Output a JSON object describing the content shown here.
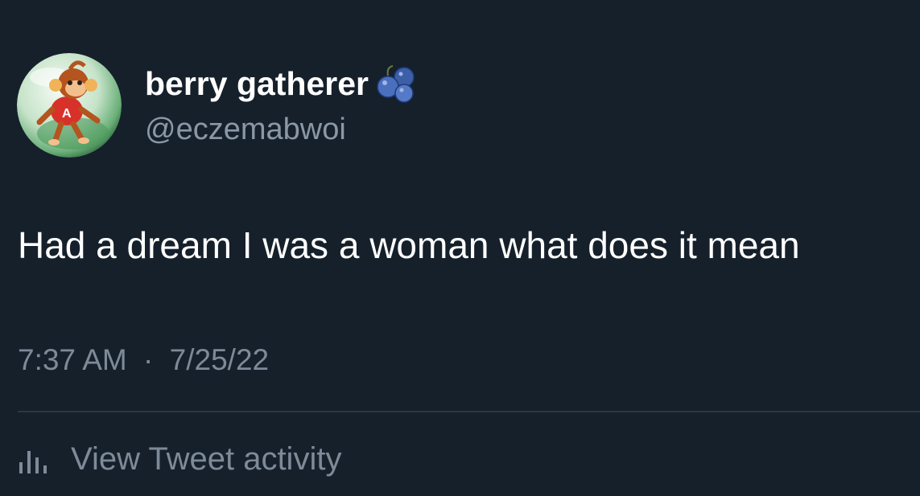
{
  "colors": {
    "background": "#16202b",
    "primary_text": "#ffffff",
    "secondary_text": "#8a98a6",
    "divider": "#2c3846"
  },
  "author": {
    "display_name": "berry gatherer",
    "name_emoji": "blueberries-icon",
    "handle": "@eczemabwoi",
    "avatar": "monkey-avatar"
  },
  "tweet": {
    "text": "Had a dream I was a woman what does it mean",
    "time": "7:37 AM",
    "separator": "·",
    "date": "7/25/22"
  },
  "activity": {
    "icon": "bar-chart-icon",
    "label": "View Tweet activity"
  }
}
